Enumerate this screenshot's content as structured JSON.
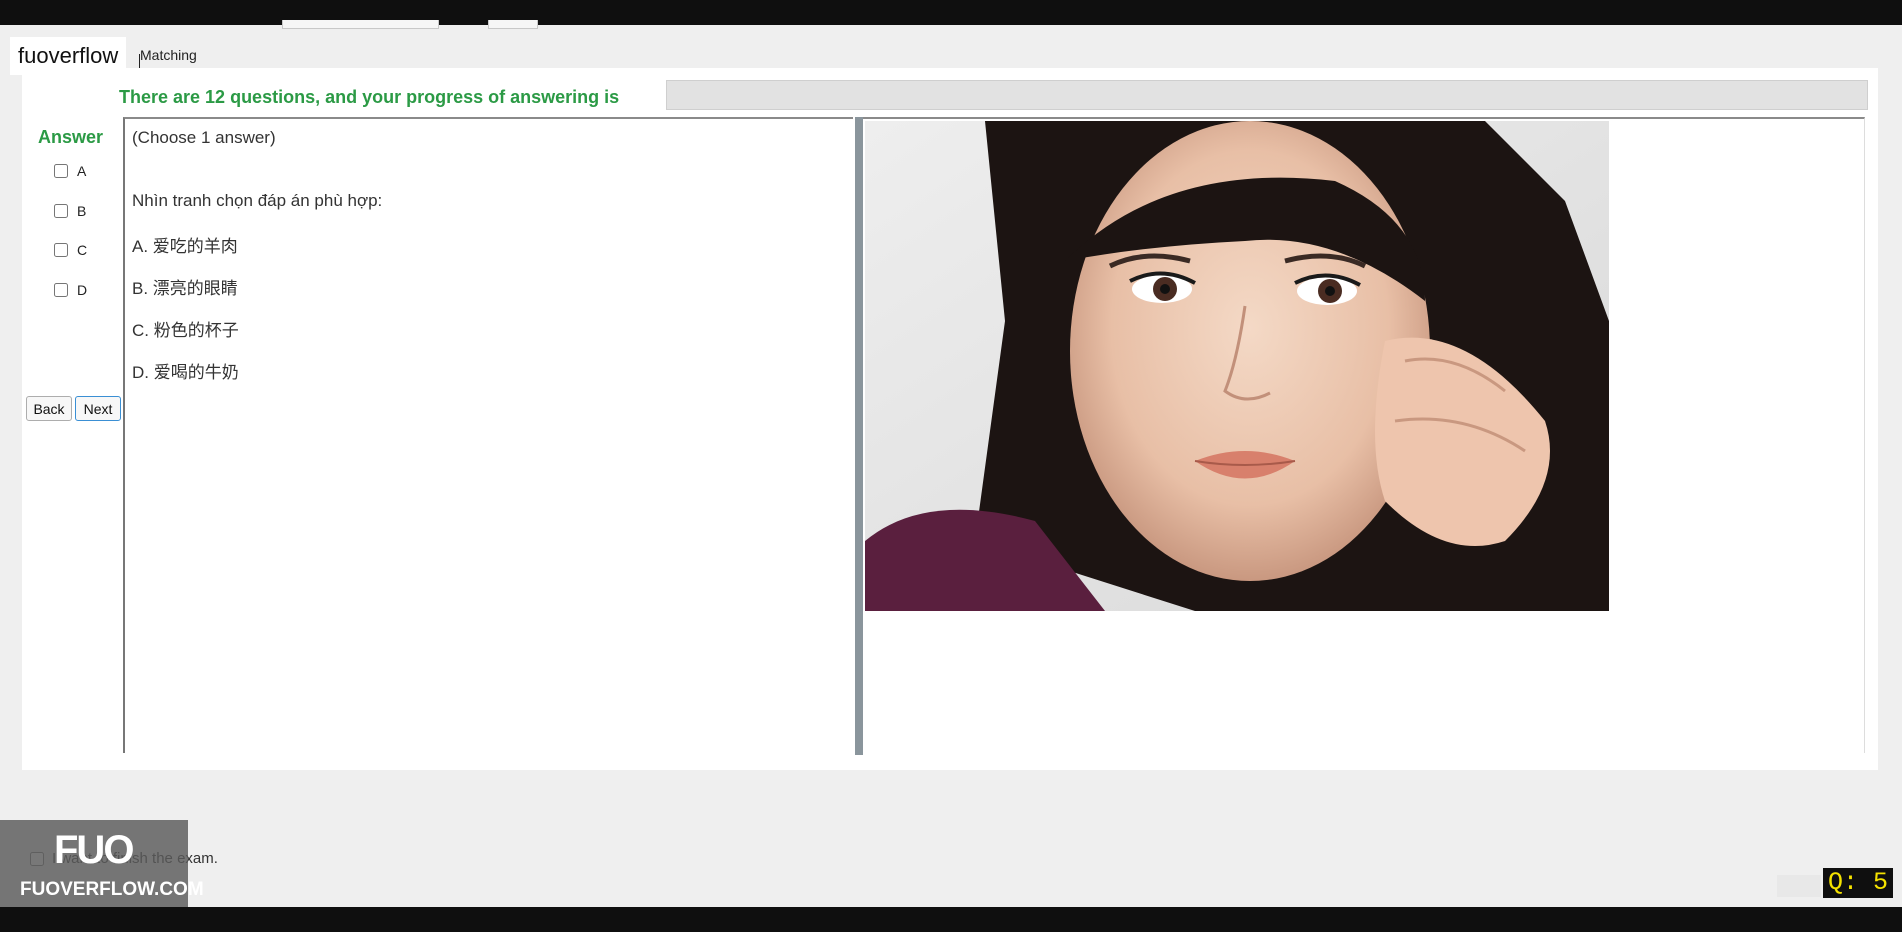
{
  "app": {
    "brand": "fuoverflow",
    "tab_label": "Matching"
  },
  "progress": {
    "label": "There are 12 questions, and your progress of answering is",
    "fraction": 0
  },
  "answer": {
    "title": "Answer",
    "options": [
      "A",
      "B",
      "C",
      "D"
    ]
  },
  "nav": {
    "back_label": "Back",
    "next_label": "Next"
  },
  "question": {
    "hint": "(Choose 1 answer)",
    "text": "Nhìn tranh chọn đáp án phù hợp:",
    "choices": [
      "A.  爱吃的羊肉",
      "B.  漂亮的眼睛",
      "C.  粉色的杯子",
      "D.  爱喝的牛奶"
    ]
  },
  "image_pane": {
    "photo_icon": "portrait-photo"
  },
  "footer": {
    "finish_label": "I want to finish the exam."
  },
  "watermark": {
    "mark": "FUO",
    "text": "FUOVERFLOW.COM"
  },
  "counter": {
    "text": "Q: 5"
  },
  "colors": {
    "accent_green": "#2b9a45",
    "counter_yellow": "#f5e200",
    "panel_bg": "#ffffff",
    "page_bg": "#efefef"
  }
}
